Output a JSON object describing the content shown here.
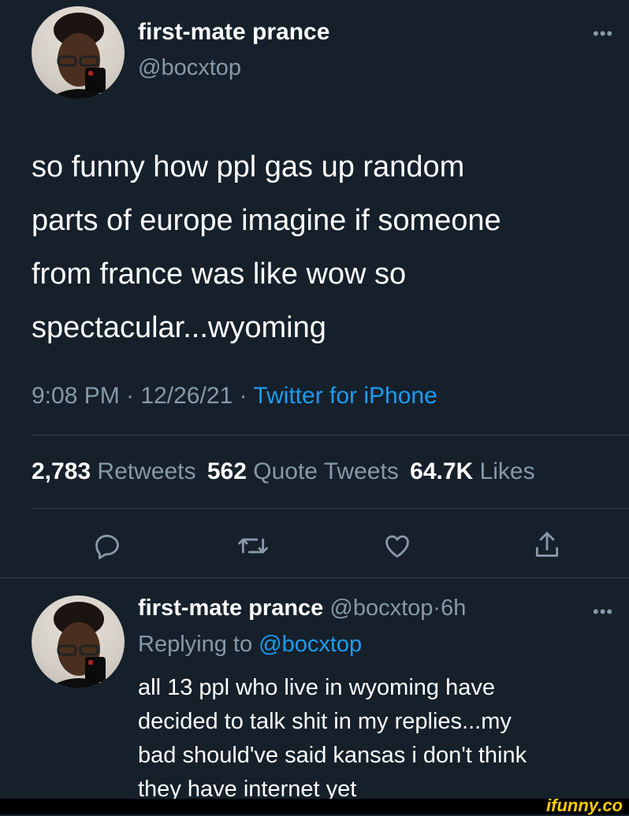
{
  "tweet": {
    "display_name": "first-mate prance",
    "handle": "@bocxtop",
    "text_lines": [
      "so funny how ppl gas up random",
      "parts of europe imagine if someone",
      "from france was like wow so",
      "spectacular...wyoming"
    ],
    "time": "9:08 PM",
    "date": "12/26/21",
    "sep": "·",
    "source": "Twitter for iPhone",
    "stats": {
      "retweets_count": "2,783",
      "retweets_label": "Retweets",
      "quotes_count": "562",
      "quotes_label": "Quote Tweets",
      "likes_count": "64.7K",
      "likes_label": "Likes"
    },
    "more_icon": "ellipsis-icon",
    "actions": [
      "reply-icon",
      "retweet-icon",
      "like-icon",
      "share-icon"
    ]
  },
  "reply": {
    "display_name": "first-mate prance",
    "handle": "@bocxtop",
    "sep": "·",
    "age": "6h",
    "replying_prefix": "Replying to",
    "replying_handle": "@bocxtop",
    "text_lines": [
      "all 13 ppl who live in wyoming have",
      "decided to talk shit in my replies...my",
      "bad should've said kansas i don't think",
      "they have internet yet"
    ]
  },
  "watermark": "ifunny.co",
  "colors": {
    "background": "#15202b",
    "text": "#ffffff",
    "muted": "#8899a6",
    "accent": "#1d9bf0",
    "watermark": "#ffcc00"
  }
}
